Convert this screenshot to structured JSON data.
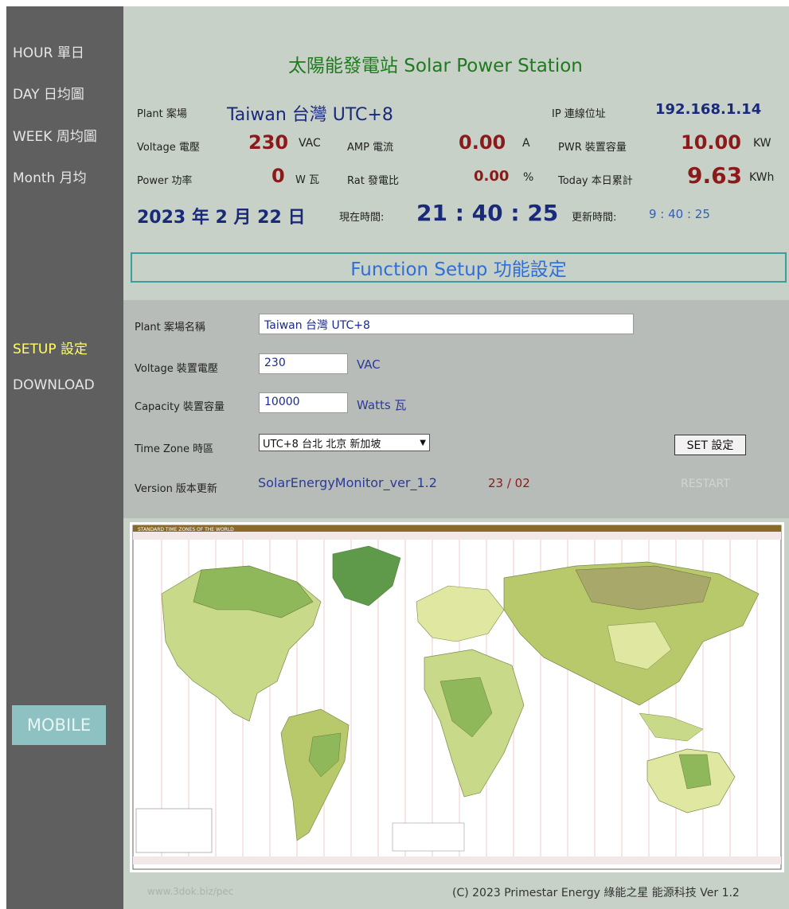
{
  "nav": {
    "hour": "HOUR 單日",
    "day": "DAY 日均圖",
    "week": "WEEK 周均圖",
    "month": "Month 月均",
    "setup": "SETUP 設定",
    "download": "DOWNLOAD",
    "mobile": "MOBILE"
  },
  "header": {
    "title": "太陽能發電站 Solar Power Station"
  },
  "status": {
    "plant_label": "Plant 案場",
    "plant_value": "Taiwan 台灣 UTC+8",
    "ip_label": "IP 連線位址",
    "ip_value": "192.168.1.14",
    "voltage_label": "Voltage 電壓",
    "voltage_value": "230",
    "voltage_unit": "VAC",
    "amp_label": "AMP 電流",
    "amp_value": "0.00",
    "amp_unit": "A",
    "pwr_label": "PWR 裝置容量",
    "pwr_value": "10.00",
    "pwr_unit": "KW",
    "power_label": "Power 功率",
    "power_value": "0",
    "power_unit": "W 瓦",
    "rat_label": "Rat 發電比",
    "rat_value": "0.00",
    "rat_unit": "%",
    "today_label": "Today 本日累計",
    "today_value": "9.63",
    "today_unit": "KWh",
    "date": "2023 年 2 月 22 日",
    "now_label": "現在時間:",
    "now_value": "21 : 40 : 25",
    "update_label": "更新時間:",
    "update_value": "9 : 40 : 25"
  },
  "function_setup": {
    "title": "Function Setup 功能設定"
  },
  "setup": {
    "plant_name_label": "Plant 案場名稱",
    "plant_name_value": "Taiwan 台灣 UTC+8",
    "voltage_label": "Voltage 裝置電壓",
    "voltage_value": "230",
    "voltage_unit": "VAC",
    "capacity_label": "Capacity 裝置容量",
    "capacity_value": "10000",
    "capacity_unit": "Watts 瓦",
    "timezone_label": "Time Zone 時區",
    "timezone_value": "UTC+8 台北 北京 新加坡",
    "set_button": "SET 設定",
    "version_label": "Version 版本更新",
    "version_value": "SolarEnergyMonitor_ver_1.2",
    "version_date": "23 / 02",
    "restart_button": "RESTART"
  },
  "map": {
    "title": "STANDARD TIME ZONES OF THE WORLD"
  },
  "footer": {
    "link": "www.3dok.biz/pec",
    "copyright": "(C) 2023 Primestar Energy 綠能之星 能源科技 Ver 1.2"
  },
  "colors": {
    "sidebar": "#5f5f5f",
    "main_bg": "#c7d1c7",
    "accent_green": "#1f7a1f",
    "value_red": "#8b1a1a",
    "accent_blue": "#2f6fd6"
  }
}
